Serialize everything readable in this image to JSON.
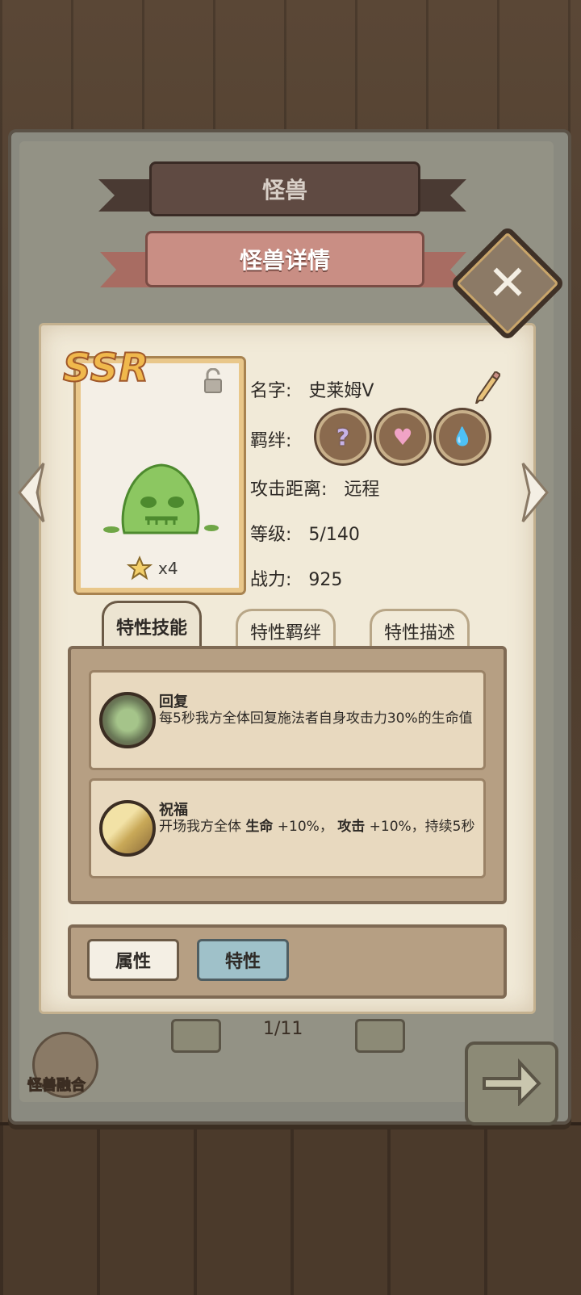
{
  "header": {
    "section_title": "怪兽",
    "dialog_title": "怪兽详情"
  },
  "close_button": {
    "label": "✕"
  },
  "card": {
    "rarity": "SSR",
    "star_count": "x4"
  },
  "info": {
    "name_label": "名字:",
    "name_value": "史莱姆Ⅴ",
    "bond_label": "羁绊:",
    "bond_icons": [
      "question-bond-icon",
      "heart-bond-icon",
      "drops-bond-icon"
    ],
    "range_label": "攻击距离:",
    "range_value": "远程",
    "level_label": "等级:",
    "level_value": "5/140",
    "power_label": "战力:",
    "power_value": "925"
  },
  "tabs": [
    {
      "label": "特性技能",
      "active": true
    },
    {
      "label": "特性羁绊",
      "active": false
    },
    {
      "label": "特性描述",
      "active": false
    }
  ],
  "skills": [
    {
      "name": "回复",
      "desc": "每5秒我方全体回复施法者自身攻击力30%的生命值",
      "icon": "heal-leaf-icon"
    },
    {
      "name": "祝福",
      "desc_parts": [
        "开场我方全体 ",
        "生命",
        " +10%， ",
        "攻击",
        " +10%，持续5秒"
      ],
      "icon": "blessing-mountain-icon"
    }
  ],
  "bottom_tabs": {
    "attr_label": "属性",
    "trait_label": "特性"
  },
  "footer": {
    "merge_label": "怪兽融合",
    "page_indicator": "1/11"
  },
  "colors": {
    "accent_active": "#9fc1c9",
    "parchment": "#f1ead8",
    "ribbon_main": "#c98e84"
  }
}
